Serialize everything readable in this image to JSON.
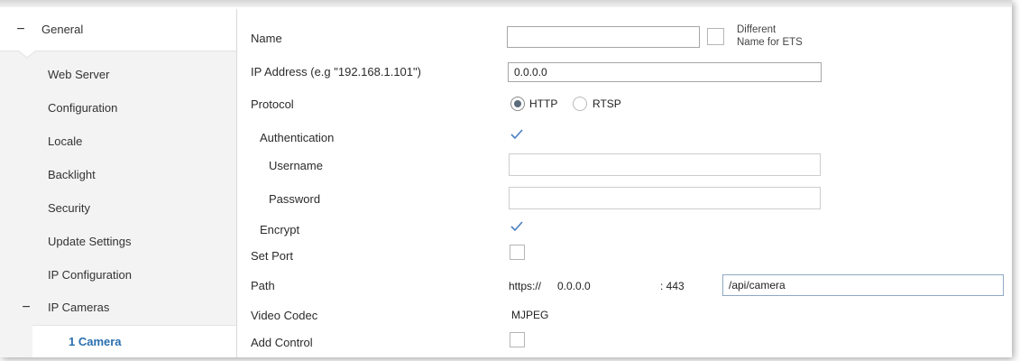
{
  "sidebar": {
    "group_general": "General",
    "items": [
      "Web Server",
      "Configuration",
      "Locale",
      "Backlight",
      "Security",
      "Update Settings",
      "IP Configuration"
    ],
    "group_ip_cameras": "IP Cameras",
    "selected_item": "1 Camera"
  },
  "form": {
    "name_label": "Name",
    "name_value": "",
    "different_name_line1": "Different",
    "different_name_line2": "Name for ETS",
    "ip_label": "IP Address (e.g \"192.168.1.101\")",
    "ip_value": "0.0.0.0",
    "protocol_label": "Protocol",
    "protocol_options": [
      "HTTP",
      "RTSP"
    ],
    "protocol_selected": "HTTP",
    "auth_label": "Authentication",
    "auth_checked": true,
    "username_label": "Username",
    "username_value": "",
    "password_label": "Password",
    "password_value": "",
    "encrypt_label": "Encrypt",
    "encrypt_checked": true,
    "set_port_label": "Set Port",
    "set_port_checked": false,
    "path_label": "Path",
    "path_scheme": "https://",
    "path_host": "0.0.0.0",
    "path_port": ": 443",
    "path_value": "/api/camera",
    "codec_label": "Video Codec",
    "codec_value": "MJPEG",
    "add_control_label": "Add Control",
    "add_control_checked": false
  },
  "colors": {
    "accent": "#2a6fb0",
    "check": "#4a7fc0"
  }
}
